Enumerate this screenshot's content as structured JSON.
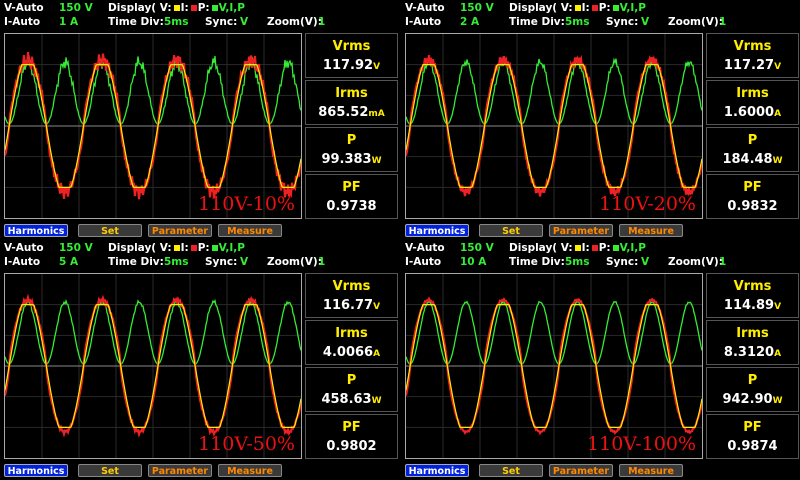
{
  "colors": {
    "voltage": "#ffee00",
    "current": "#ee2222",
    "power": "#33ee33",
    "grid": "#2a2a2a"
  },
  "buttons": {
    "harmonics": "Harmonics",
    "set": "Set",
    "parameter": "Parameter",
    "measure": "Measure"
  },
  "header": {
    "v_auto": "V-Auto",
    "i_auto": "I-Auto",
    "display": "Display( V:",
    "i": "I:",
    "p": "P:",
    "display_end": "V,I,P",
    "time_div": "Time  Div:",
    "sync": "Sync:",
    "zoom": "Zoom(V):"
  },
  "panels": [
    {
      "v_range": "150  V",
      "i_range": "1  A",
      "time_div": "5ms",
      "sync": "V",
      "zoom": "1",
      "tag": "110V-10%",
      "vrms_label": "Vrms",
      "vrms": "117.92",
      "vrms_unit": "V",
      "irms_label": "Irms",
      "irms": "865.52",
      "irms_unit": "mA",
      "p_label": "P",
      "p": "99.383",
      "p_unit": "W",
      "pf_label": "PF",
      "pf": "0.9738",
      "noise": 1.0
    },
    {
      "v_range": "150  V",
      "i_range": "2  A",
      "time_div": "5ms",
      "sync": "V",
      "zoom": "1",
      "tag": "110V-20%",
      "vrms_label": "Vrms",
      "vrms": "117.27",
      "vrms_unit": "V",
      "irms_label": "Irms",
      "irms": "1.6000",
      "irms_unit": "A",
      "p_label": "P",
      "p": "184.48",
      "p_unit": "W",
      "pf_label": "PF",
      "pf": "0.9832",
      "noise": 0.6
    },
    {
      "v_range": "150  V",
      "i_range": "5  A",
      "time_div": "5ms",
      "sync": "V",
      "zoom": "1",
      "tag": "110V-50%",
      "vrms_label": "Vrms",
      "vrms": "116.77",
      "vrms_unit": "V",
      "irms_label": "Irms",
      "irms": "4.0066",
      "irms_unit": "A",
      "p_label": "P",
      "p": "458.63",
      "p_unit": "W",
      "pf_label": "PF",
      "pf": "0.9802",
      "noise": 0.3
    },
    {
      "v_range": "150  V",
      "i_range": "10  A",
      "time_div": "5ms",
      "sync": "V",
      "zoom": "1",
      "tag": "110V-100%",
      "vrms_label": "Vrms",
      "vrms": "114.89",
      "vrms_unit": "V",
      "irms_label": "Irms",
      "irms": "8.3120",
      "irms_unit": "A",
      "p_label": "P",
      "p": "942.90",
      "p_unit": "W",
      "pf_label": "PF",
      "pf": "0.9874",
      "noise": 0.15
    }
  ]
}
